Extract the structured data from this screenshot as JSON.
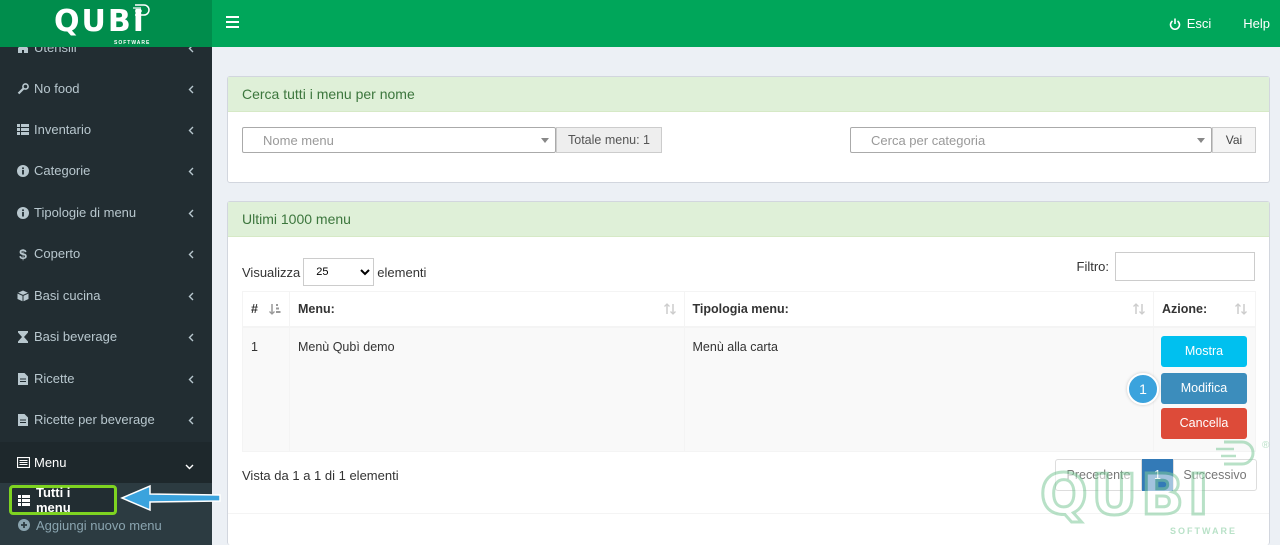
{
  "brand": {
    "name": "QUBI",
    "sub": "SOFTWARE"
  },
  "topbar": {
    "logout_label": "Esci",
    "help_label": "Help"
  },
  "sidebar": {
    "items": [
      {
        "label": "Utensili",
        "icon": "home-icon"
      },
      {
        "label": "No food",
        "icon": "wrench-icon"
      },
      {
        "label": "Inventario",
        "icon": "list-icon"
      },
      {
        "label": "Categorie",
        "icon": "info-icon"
      },
      {
        "label": "Tipologie di menu",
        "icon": "info-icon"
      },
      {
        "label": "Coperto",
        "icon": "dollar-icon"
      },
      {
        "label": "Basi cucina",
        "icon": "cube-icon"
      },
      {
        "label": "Basi beverage",
        "icon": "hourglass-icon"
      },
      {
        "label": "Ricette",
        "icon": "file-icon"
      },
      {
        "label": "Ricette per beverage",
        "icon": "file-icon"
      },
      {
        "label": "Menu",
        "icon": "menu-icon"
      }
    ],
    "submenu": [
      {
        "label": "Tutti i menu"
      },
      {
        "label": "Aggiungi nuovo menu"
      }
    ]
  },
  "search_box": {
    "title": "Cerca tutti i menu per nome",
    "name_placeholder": "Nome menu",
    "total_label": "Totale menu: 1",
    "category_placeholder": "Cerca per categoria",
    "go_label": "Vai"
  },
  "list_box": {
    "title": "Ultimi 1000 menu",
    "show_label": "Visualizza",
    "page_size": "25",
    "page_size_options": [
      "25"
    ],
    "elements_label": "elementi",
    "filter_label": "Filtro:",
    "columns": [
      "#",
      "Menu:",
      "Tipologia menu:",
      "Azione:"
    ],
    "rows": [
      {
        "num": "1",
        "menu": "Menù Qubì demo",
        "type": "Menù alla carta"
      }
    ],
    "actions": {
      "show": "Mostra",
      "edit": "Modifica",
      "delete": "Cancella"
    },
    "info": "Vista da 1 a 1 di 1 elementi",
    "pager": {
      "prev": "Precedente",
      "current": "1",
      "next": "Successivo"
    }
  },
  "annotation": {
    "step": "1"
  },
  "colors": {
    "brand_green": "#00a65a",
    "sidebar_bg": "#222d32",
    "info": "#00c0ef",
    "primary": "#3c8dbc",
    "danger": "#dd4b39",
    "highlight": "#7ed321",
    "arrow": "#3ba3dd"
  }
}
